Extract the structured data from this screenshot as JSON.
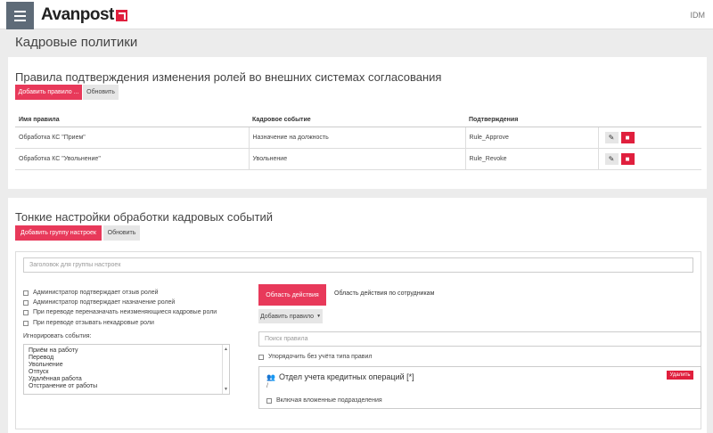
{
  "header": {
    "logo_text": "Avanpost",
    "app_name": "IDM"
  },
  "page": {
    "title": "Кадровые политики"
  },
  "approval_rules": {
    "title": "Правила подтверждения изменения ролей во внешних системах согласования",
    "add_button": "Добавить правило ...",
    "refresh_button": "Обновить",
    "columns": [
      "Имя правила",
      "Кадровое событие",
      "Подтверждения"
    ],
    "rows": [
      {
        "name": "Обработка КС \"Прием\"",
        "event": "Назначение на должность",
        "approval": "Rule_Approve"
      },
      {
        "name": "Обработка КС \"Увольнение\"",
        "event": "Увольнение",
        "approval": "Rule_Revoke"
      }
    ]
  },
  "fine_settings": {
    "title": "Тонкие настройки обработки кадровых событий",
    "add_group_button": "Добавить группу настроек",
    "refresh_button": "Обновить",
    "group_title_placeholder": "Заголовок для группы настроек",
    "checkboxes": [
      {
        "label": "Администратор подтверждает отзыв ролей",
        "checked": false
      },
      {
        "label": "Администратор подтверждает назначение ролей",
        "checked": false
      },
      {
        "label": "При переводе переназначать неизменяющиеся кадровые роли",
        "checked": false
      },
      {
        "label": "При переводе отзывать некадровые роли",
        "checked": false
      }
    ],
    "ignore_events_label": "Игнорировать события:",
    "ignore_events": [
      "Приём на работу",
      "Перевод",
      "Увольнение",
      "Отпуск",
      "Удалённая работа",
      "Отстранение от работы"
    ],
    "scope_tab_active": "Область действия",
    "scope_tab_employees": "Область действия по сотрудникам",
    "add_rule_dropdown": "Добавить правило",
    "search_placeholder": "Поиск правила",
    "sort_checkbox_label": "Упорядочить без учёта типа правил",
    "department": {
      "name": "Отдел учета кредитных операций [*]",
      "path": "/",
      "remove_button": "Удалить",
      "include_nested_label": "Включая вложенные подразделения"
    }
  },
  "colors": {
    "accent": "#e8395a",
    "danger": "#e01f3d",
    "header_menu": "#5e6b78",
    "background": "#ececec"
  }
}
